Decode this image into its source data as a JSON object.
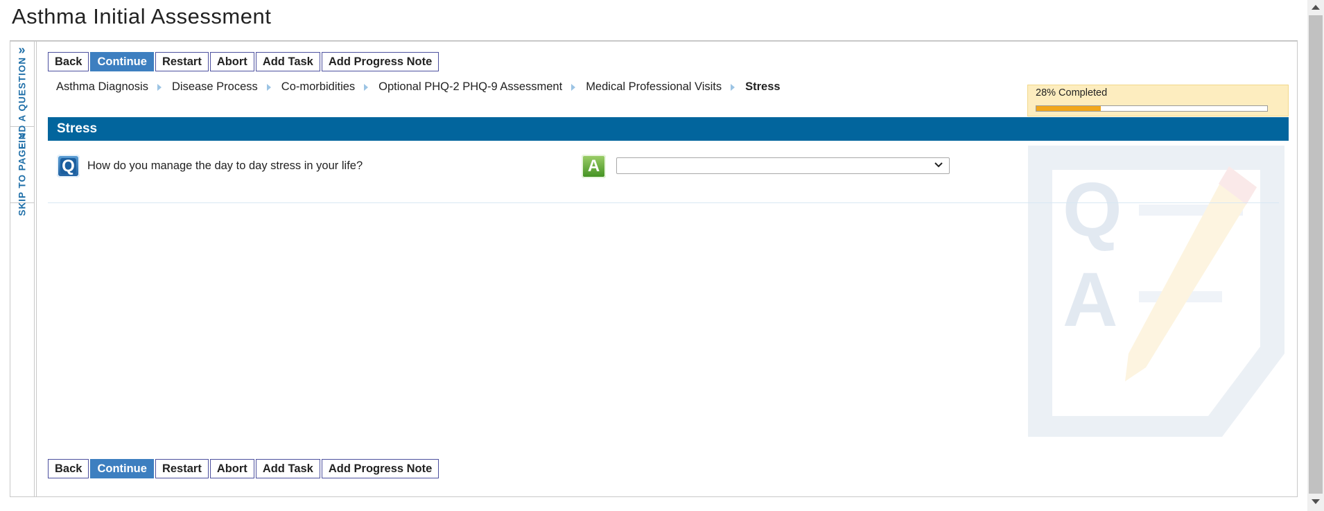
{
  "page": {
    "title": "Asthma Initial Assessment"
  },
  "side_tabs": [
    {
      "label": "FIND A QUESTION",
      "icon": "double-chevron-right-icon"
    },
    {
      "label": "SKIP TO PAGE",
      "icon": "double-chevron-right-icon"
    }
  ],
  "toolbar": {
    "back": "Back",
    "continue": "Continue",
    "restart": "Restart",
    "abort": "Abort",
    "add_task": "Add Task",
    "add_progress_note": "Add Progress Note"
  },
  "breadcrumb": [
    "Asthma Diagnosis",
    "Disease Process",
    "Co-morbidities",
    "Optional PHQ-2 PHQ-9 Assessment",
    "Medical Professional Visits",
    "Stress"
  ],
  "progress": {
    "label": "28% Completed",
    "percent": 28,
    "color": "#f2a71c"
  },
  "section": {
    "title": "Stress",
    "color": "#02659d"
  },
  "question": {
    "icon_letter": "Q",
    "text": "How do you manage the day to day stress in your life?"
  },
  "answer": {
    "icon_letter": "A",
    "selected_value": ""
  },
  "colors": {
    "primary_button": "#3d7fc0",
    "accent_blue": "#1f6fa8"
  }
}
